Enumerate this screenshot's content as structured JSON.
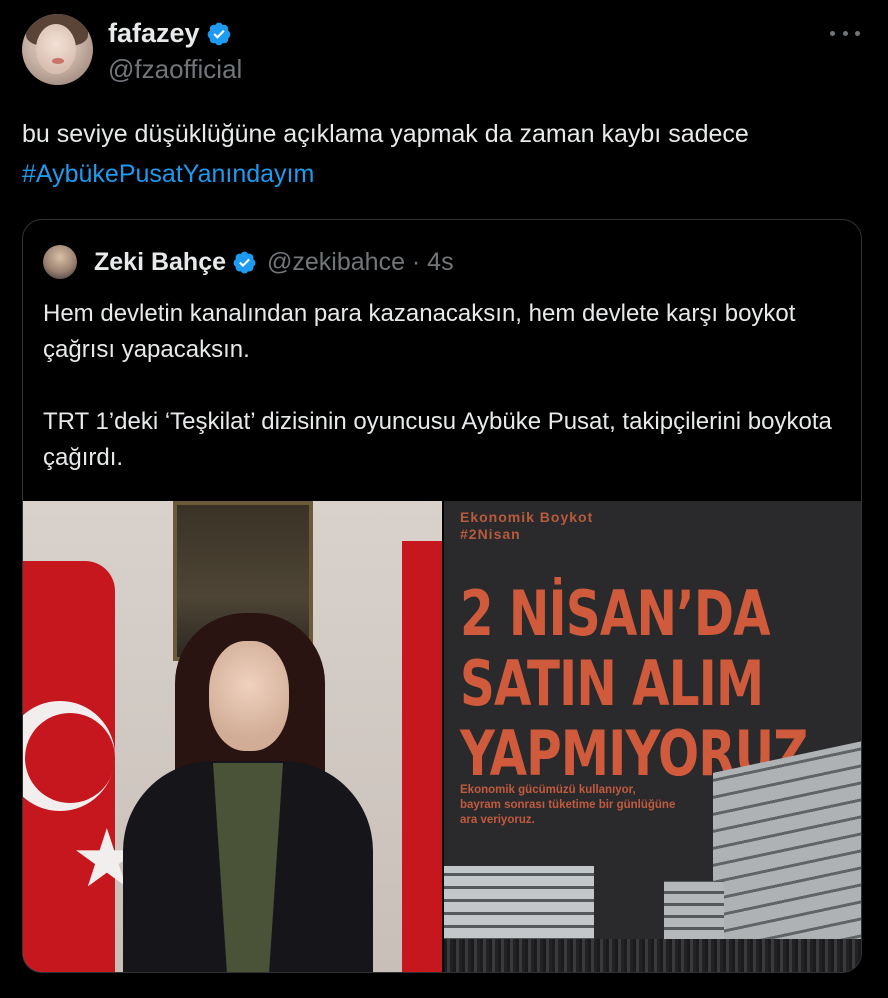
{
  "tweet": {
    "display_name": "fafazey",
    "handle": "@fzaofficial",
    "text_part1": "bu seviye düşüklüğüne açıklama yapmak da zaman kaybı sadece ",
    "hashtag": "#AybükePusatYanındayım"
  },
  "quoted_tweet": {
    "display_name": "Zeki Bahçe",
    "handle_time": "@zekibahce · 4s",
    "paragraph1": "Hem devletin kanalından para kazanacaksın, hem devlete karşı boykot çağrısı yapacaksın.",
    "paragraph2": "TRT 1’deki ‘Teşkilat’ dizisinin oyuncusu Aybüke Pusat, takipçilerini boykota çağırdı."
  },
  "poster": {
    "tag1": "Ekonomik Boykot",
    "tag2": "#2Nisan",
    "title_line1": "2 NİSAN’DA",
    "title_line2": "SATIN ALIM",
    "title_line3": "YAPMIYORUZ",
    "sub_line1": "Ekonomik gücümüzü kullanıyor,",
    "sub_line2": "bayram sonrası tüketime bir günlüğüne",
    "sub_line3": "ara veriyoruz."
  },
  "colors": {
    "accent": "#1d9bf0",
    "background": "#000000",
    "secondary_text": "#71767b",
    "verified_badge": "#1d9bf0",
    "poster_text": "#d05a3c"
  },
  "icons": {
    "verified": "verified-badge-icon",
    "more": "more-options-icon"
  }
}
